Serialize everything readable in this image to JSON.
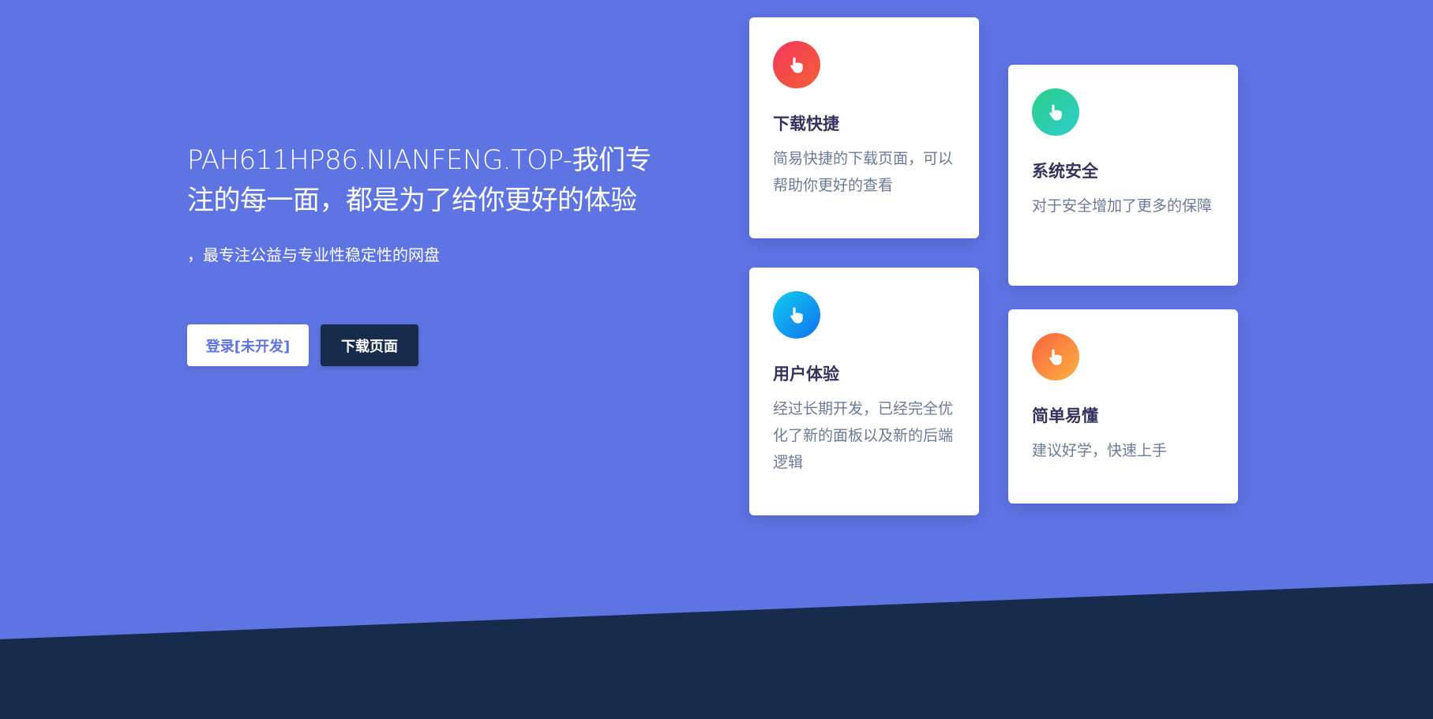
{
  "hero": {
    "headline": "PAH611HP86.NIANFENG.TOP-我们专注的每一面，都是为了给你更好的体验",
    "subtitle": "，最专注公益与专业性稳定性的网盘",
    "login_button": "登录[未开发]",
    "download_button": "下载页面"
  },
  "features": {
    "download": {
      "title": "下载快捷",
      "text": "简易快捷的下载页面，可以帮助你更好的查看",
      "icon": "hand-pointer-icon",
      "color_from": "#f5365c",
      "color_to": "#f56036"
    },
    "security": {
      "title": "系统安全",
      "text": "对于安全增加了更多的保障",
      "icon": "hand-pointer-icon",
      "color_from": "#2dce89",
      "color_to": "#2dcecc"
    },
    "ux": {
      "title": "用户体验",
      "text": "经过长期开发，已经完全优化了新的面板以及新的后端逻辑",
      "icon": "hand-pointer-icon",
      "color_from": "#11cdef",
      "color_to": "#1171ef"
    },
    "easy": {
      "title": "简单易懂",
      "text": "建议好学，快速上手",
      "icon": "hand-pointer-icon",
      "color_from": "#fb6340",
      "color_to": "#fbb140"
    }
  },
  "colors": {
    "hero_bg": "#5f74e3",
    "footer_bg": "#172b4d"
  }
}
